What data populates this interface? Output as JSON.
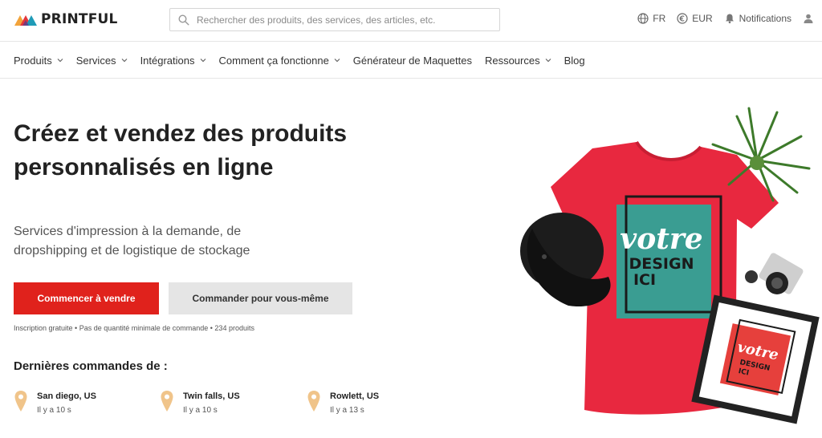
{
  "brand": {
    "name": "PRINTFUL"
  },
  "search": {
    "placeholder": "Rechercher des produits, des services, des articles, etc."
  },
  "top_right": {
    "language": "FR",
    "currency": "EUR",
    "notifications": "Notifications"
  },
  "nav": {
    "items": [
      {
        "label": "Produits",
        "dropdown": true
      },
      {
        "label": "Services",
        "dropdown": true
      },
      {
        "label": "Intégrations",
        "dropdown": true
      },
      {
        "label": "Comment ça fonctionne",
        "dropdown": true
      },
      {
        "label": "Générateur de Maquettes",
        "dropdown": false
      },
      {
        "label": "Ressources",
        "dropdown": true
      },
      {
        "label": "Blog",
        "dropdown": false
      }
    ]
  },
  "hero": {
    "title": "Créez et vendez des produits personnalisés en ligne",
    "subtitle": "Services d'impression à la demande, de dropshipping et de logistique de stockage",
    "primary_cta": "Commencer à vendre",
    "secondary_cta": "Commander pour vous-même",
    "note": "Inscription gratuite • Pas de quantité minimale de commande • 234 produits",
    "image": {
      "shirt_text_line1": "votre",
      "shirt_text_line2": "DESIGN",
      "shirt_text_line3": "ICI",
      "frame_text_line1": "votre",
      "frame_text_line2": "DESIGN",
      "frame_text_line3": "ICI"
    }
  },
  "orders": {
    "title": "Dernières commandes de :",
    "items": [
      {
        "city": "San diego, US",
        "time": "Il y a 10 s"
      },
      {
        "city": "Twin falls, US",
        "time": "Il y a 10 s"
      },
      {
        "city": "Rowlett, US",
        "time": "Il y a 13 s"
      }
    ]
  },
  "colors": {
    "accent": "#e0221c",
    "secondary_button": "#e5e5e5",
    "pin": "#f0c48a",
    "tshirt": "#e8283f",
    "teal": "#3a9d92"
  }
}
